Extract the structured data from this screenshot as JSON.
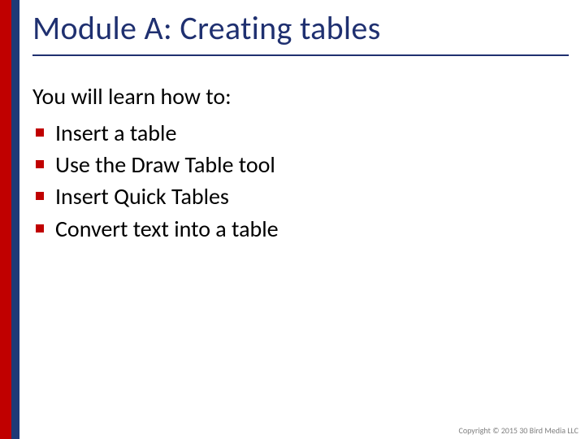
{
  "title": "Module A: Creating  tables",
  "intro": "You will learn how to:",
  "bullets": [
    "Insert a table",
    "Use the Draw Table tool",
    "Insert Quick Tables",
    "Convert text into a table"
  ],
  "copyright": "Copyright © 2015 30 Bird Media LLC",
  "colors": {
    "red": "#c00000",
    "blue": "#1f3a77",
    "titleText": "#1f3070"
  }
}
